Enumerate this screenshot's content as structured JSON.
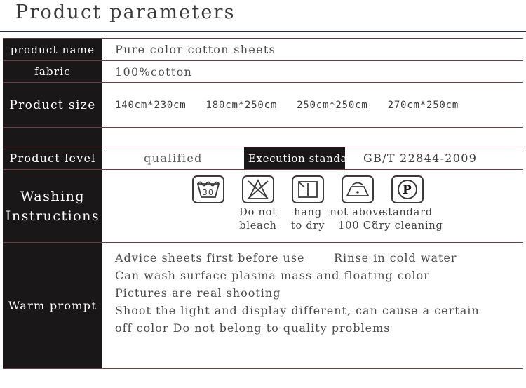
{
  "page": {
    "title": "Product parameters"
  },
  "table": {
    "rows": {
      "product_name": {
        "label": "product name",
        "value": "Pure color cotton sheets"
      },
      "fabric": {
        "label": "fabric",
        "value": "100%cotton"
      },
      "product_size": {
        "label": "Product size",
        "sizes": [
          "140cm*230cm",
          "180cm*250cm",
          "250cm*250cm",
          "270cm*250cm"
        ]
      },
      "blank": {
        "label": "",
        "value": ""
      },
      "product_level": {
        "label": "Product level",
        "value": "qualified",
        "execution_standard_label": "Execution standard",
        "execution_standard_value": "GB/T 22844-2009"
      },
      "washing_instructions": {
        "label_line1": "Washing",
        "label_line2": "Instructions",
        "icons": [
          {
            "icon": "wash-tub-30-icon",
            "temperature": "30",
            "caption_line1": "",
            "caption_line2": ""
          },
          {
            "icon": "do-not-bleach-icon",
            "caption_line1": "Do not",
            "caption_line2": "bleach"
          },
          {
            "icon": "hang-to-dry-icon",
            "caption_line1": "hang",
            "caption_line2": "to dry"
          },
          {
            "icon": "iron-low-heat-icon",
            "caption_line1": "not above",
            "caption_line2": "100 C°"
          },
          {
            "icon": "dry-clean-p-icon",
            "symbol_letter": "P",
            "caption_line1": "standard",
            "caption_line2": "dry cleaning"
          }
        ]
      },
      "warm_prompt": {
        "label": "Warm prompt",
        "lines": [
          "Advice sheets first before use",
          "Can wash surface plasma mass and floating color",
          "Pictures are real shooting",
          "Shoot the light and display different, can cause a certain",
          "off color Do not belong to quality problems"
        ],
        "overlap_text": "Rinse in cold water"
      }
    }
  },
  "colors": {
    "label_background": "#1a1718",
    "label_text": "#ffffff",
    "value_text": "#4a4a4a",
    "border": "#6b4040",
    "title_text": "#3a3a3a",
    "page_background": "#ffffff"
  }
}
